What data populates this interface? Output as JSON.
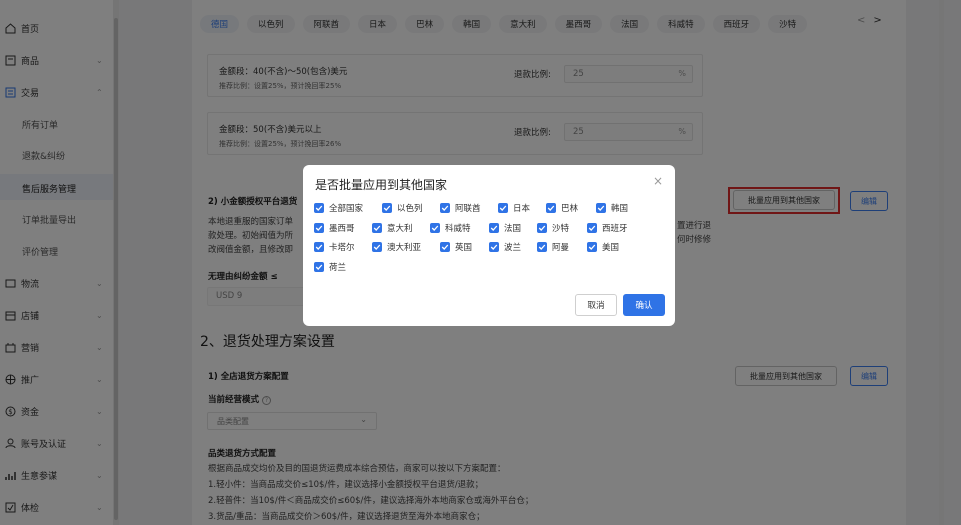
{
  "sidebar": {
    "items": [
      {
        "label": "首页",
        "icon": "home-icon"
      },
      {
        "label": "商品",
        "icon": "product-icon"
      },
      {
        "label": "交易",
        "icon": "trade-icon"
      },
      {
        "label": "物流",
        "icon": "logistics-icon"
      },
      {
        "label": "店铺",
        "icon": "store-icon"
      },
      {
        "label": "营销",
        "icon": "marketing-icon"
      },
      {
        "label": "推广",
        "icon": "promotion-icon"
      },
      {
        "label": "资金",
        "icon": "funds-icon"
      },
      {
        "label": "账号及认证",
        "icon": "account-icon"
      },
      {
        "label": "生意参谋",
        "icon": "analytics-icon"
      },
      {
        "label": "体检",
        "icon": "checkup-icon"
      }
    ],
    "sub_items": [
      "所有订单",
      "退款&纠纷",
      "售后服务管理",
      "订单批量导出",
      "评价管理"
    ]
  },
  "tabs": [
    "德国",
    "以色列",
    "阿联酋",
    "日本",
    "巴林",
    "韩国",
    "意大利",
    "墨西哥",
    "法国",
    "科威特",
    "西班牙",
    "沙特"
  ],
  "tiers": [
    {
      "title": "金额段：40(不含)～50(包含)美元",
      "sub": "推荐比例：设置25%，预计挽回率25%",
      "label": "退款比例:",
      "value": "25",
      "unit": "%"
    },
    {
      "title": "金额段：50(不含)美元以上",
      "sub": "推荐比例：设置25%，预计挽回率26%",
      "label": "退款比例:",
      "value": "25",
      "unit": "%"
    }
  ],
  "section2": {
    "title": "2) 小金额授权平台退货",
    "para_left": [
      "本地退重服的国家订单",
      "款处理。初始阀值为所",
      "改阀值金额，且修改即"
    ],
    "para_right": [
      "置进行退",
      "何时修修"
    ],
    "no_dispute_label": "无理由纠纷金额 ≤",
    "usd_value": "USD  9",
    "batch_btn": "批量应用到其他国家",
    "edit_btn": "编辑"
  },
  "return_plan": {
    "heading": "2、退货处理方案设置",
    "sub_title": "1) 全店退货方案配置",
    "batch_btn": "批量应用到其他国家",
    "edit_btn": "编辑",
    "mode_label": "当前经营模式",
    "help": "?",
    "select_value": "品类配置",
    "select_chevron": "⌄",
    "category_title": "品类退货方式配置",
    "lines": [
      "根据商品成交均价及目的国退货运费成本综合预估，商家可以按以下方案配置：",
      "1.轻小件：当商品成交价≤10$/件，建议选择小金额授权平台退货/退款；",
      "2.轻普件：当10$/件＜商品成交价≤60$/件，建议选择海外本地商家仓或海外平台仓；",
      "3.货品/重品：当商品成交价＞60$/件，建议选择退货至海外本地商家仓；"
    ]
  },
  "modal": {
    "title": "是否批量应用到其他国家",
    "close": "×",
    "options": [
      "全部国家",
      "以色列",
      "阿联酋",
      "日本",
      "巴林",
      "韩国",
      "墨西哥",
      "意大利",
      "科威特",
      "法国",
      "沙特",
      "西班牙",
      "卡塔尔",
      "澳大利亚",
      "英国",
      "波兰",
      "阿曼",
      "美国",
      "荷兰"
    ],
    "cancel": "取消",
    "confirm": "确认"
  },
  "colors": {
    "primary": "#2f73e6",
    "highlight": "#e12d2d"
  }
}
